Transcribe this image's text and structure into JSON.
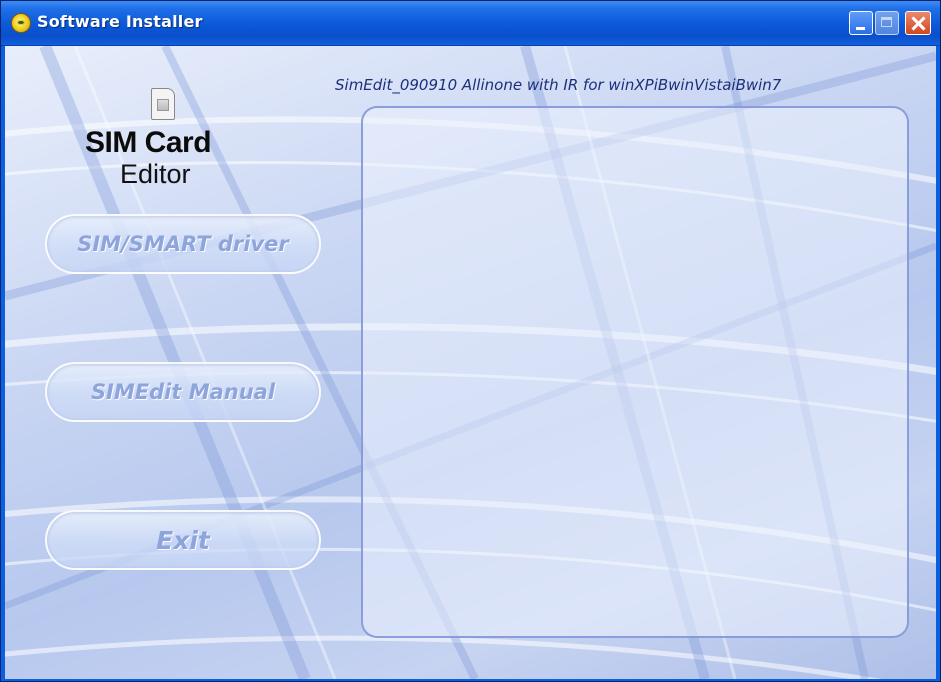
{
  "window": {
    "title": "Software Installer",
    "icon": "installer-app-icon",
    "titlebar_color": "#0b58d8",
    "controls": [
      "minimize",
      "maximize",
      "close"
    ]
  },
  "header": {
    "product_title": "SimEdit_090910 Allinone with IR for winXPiBwinVistaiBwin7"
  },
  "logo": {
    "line1": "SIM Card",
    "line2": "Editor",
    "icon": "sim-chip-icon"
  },
  "menu": {
    "driver_label": "SIM/SMART driver",
    "manual_label": "SIMEdit Manual",
    "exit_label": "Exit"
  },
  "colors": {
    "button_text": "#8ea5dc",
    "background": "#c9d6f3",
    "panel_border": "#8296d7"
  }
}
